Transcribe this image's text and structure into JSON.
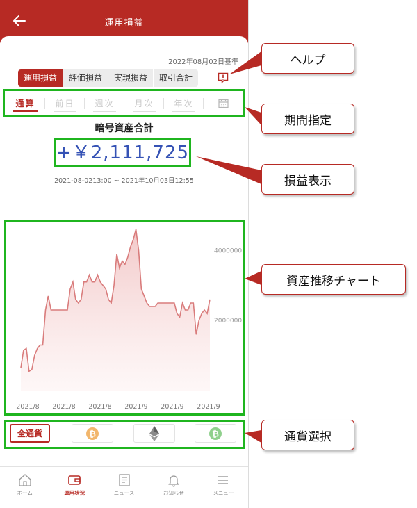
{
  "header": {
    "title": "運用損益"
  },
  "as_of": "2022年08月02日基準",
  "tabs": [
    {
      "label": "運用損益",
      "active": true
    },
    {
      "label": "評価損益",
      "active": false
    },
    {
      "label": "実現損益",
      "active": false
    },
    {
      "label": "取引合計",
      "active": false
    }
  ],
  "periods": [
    {
      "label": "通算",
      "active": true
    },
    {
      "label": "前日",
      "active": false
    },
    {
      "label": "週次",
      "active": false
    },
    {
      "label": "月次",
      "active": false
    },
    {
      "label": "年次",
      "active": false
    }
  ],
  "asset_title": "暗号資産合計",
  "amount": "+￥2,111,725",
  "date_range": "2021-08-0213:00 ~ 2021年10月03日12:55",
  "chart_data": {
    "type": "area",
    "x_ticks": [
      "2021/8",
      "2021/8",
      "2021/8",
      "2021/9",
      "2021/9",
      "2021/9"
    ],
    "y_ticks": [
      "4000000",
      "2000000"
    ],
    "ylim": [
      0,
      4800000
    ],
    "line_color": "#d97c7c",
    "fill_color": "#f5d4d4",
    "values": [
      650000,
      1150000,
      1200000,
      550000,
      600000,
      1000000,
      1200000,
      1300000,
      1300000,
      2300000,
      2700000,
      2300000,
      2300000,
      2300000,
      2300000,
      2300000,
      2300000,
      2300000,
      2900000,
      3100000,
      2600000,
      2500000,
      2600000,
      3100000,
      3100000,
      3300000,
      3100000,
      3100000,
      3300000,
      3100000,
      3000000,
      2900000,
      2600000,
      2500000,
      3000000,
      3900000,
      3500000,
      3700000,
      3600000,
      3800000,
      4100000,
      4300000,
      4600000,
      4000000,
      2900000,
      2700000,
      2500000,
      2400000,
      2400000,
      2400000,
      2500000,
      2500000,
      2500000,
      2500000,
      2500000,
      2500000,
      2500000,
      2200000,
      2100000,
      2500000,
      2300000,
      2300000,
      2500000,
      2500000,
      1600000,
      2000000,
      2200000,
      2300000,
      2200000,
      2600000
    ]
  },
  "currency": {
    "all_label": "全通貨",
    "coins": [
      {
        "name": "bitcoin",
        "color": "#f2b66c"
      },
      {
        "name": "ethereum",
        "color": "#8a8a8a"
      },
      {
        "name": "bitcoin-cash",
        "color": "#8fd08c"
      }
    ]
  },
  "nav": [
    {
      "label": "ホーム",
      "icon": "home-icon",
      "active": false
    },
    {
      "label": "運用状況",
      "icon": "wallet-icon",
      "active": true
    },
    {
      "label": "ニュース",
      "icon": "news-icon",
      "active": false
    },
    {
      "label": "お知らせ",
      "icon": "bell-icon",
      "active": false
    },
    {
      "label": "メニュー",
      "icon": "menu-icon",
      "active": false
    }
  ],
  "callouts": {
    "help": "ヘルプ",
    "period": "期間指定",
    "amount": "損益表示",
    "chart": "資産推移チャート",
    "currency": "通貨選択"
  },
  "colors": {
    "brand": "#b72a24",
    "highlight": "#1fb51f",
    "amount": "#3552b5"
  }
}
